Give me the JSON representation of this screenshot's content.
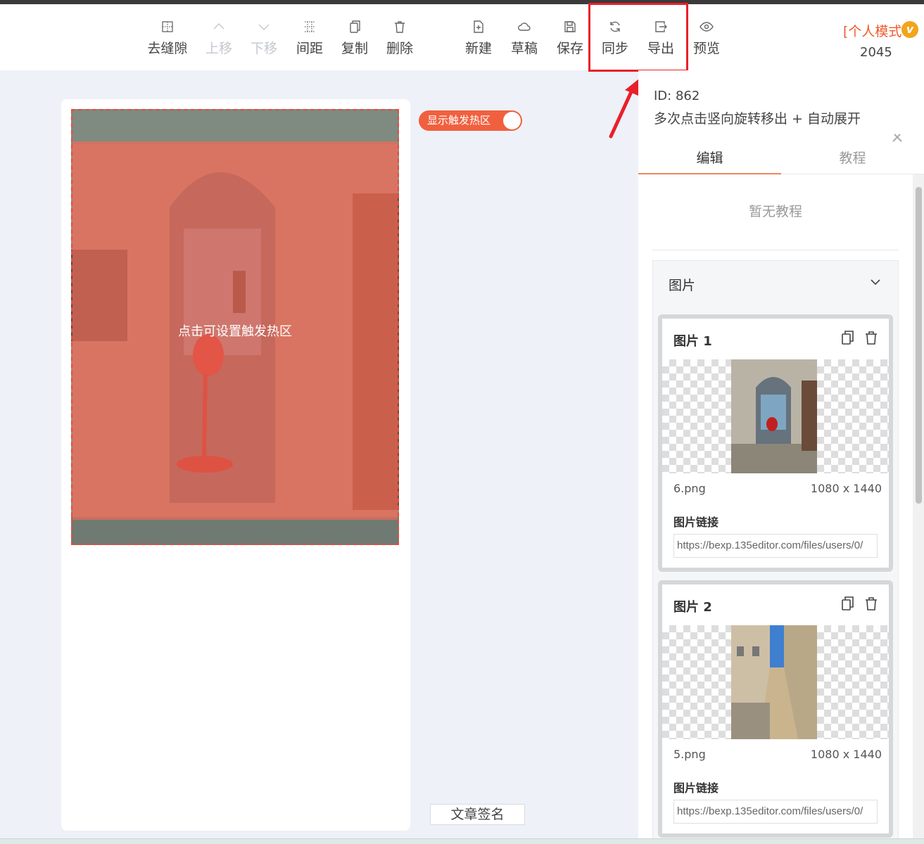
{
  "toolbar": {
    "items": [
      {
        "label": "去缝隙",
        "icon": "grid-dotted-icon",
        "disabled": false
      },
      {
        "label": "上移",
        "icon": "chevron-up-icon",
        "disabled": true
      },
      {
        "label": "下移",
        "icon": "chevron-down-icon",
        "disabled": true
      },
      {
        "label": "间距",
        "icon": "spacing-grid-icon",
        "disabled": false
      },
      {
        "label": "复制",
        "icon": "copy-icon",
        "disabled": false
      },
      {
        "label": "删除",
        "icon": "trash-icon",
        "disabled": false
      },
      {
        "label": "新建",
        "icon": "new-file-icon",
        "disabled": false
      },
      {
        "label": "草稿",
        "icon": "cloud-icon",
        "disabled": false
      },
      {
        "label": "保存",
        "icon": "save-icon",
        "disabled": false
      },
      {
        "label": "同步",
        "icon": "sync-icon",
        "disabled": false
      },
      {
        "label": "导出",
        "icon": "export-icon",
        "disabled": false
      },
      {
        "label": "预览",
        "icon": "eye-icon",
        "disabled": false
      }
    ],
    "mode": "[个人模式",
    "badge": "v",
    "user_id": "2045"
  },
  "canvas": {
    "hotzone_text": "点击可设置触发热区",
    "toggle_label": "显示触发热区",
    "toggle_on": true,
    "signature_button": "文章签名"
  },
  "panel": {
    "id_text": "ID: 862",
    "description": "多次点击竖向旋转移出 + 自动展开",
    "tabs": [
      {
        "label": "编辑",
        "active": true
      },
      {
        "label": "教程",
        "active": false
      }
    ],
    "no_tutorial": "暂无教程",
    "section_title": "图片",
    "images": [
      {
        "title": "图片 1",
        "filename": "6.png",
        "dimensions": "1080 x 1440",
        "link_label": "图片链接",
        "link_value": "https://bexp.135editor.com/files/users/0/"
      },
      {
        "title": "图片 2",
        "filename": "5.png",
        "dimensions": "1080 x 1440",
        "link_label": "图片链接",
        "link_value": "https://bexp.135editor.com/files/users/0/"
      }
    ]
  },
  "colors": {
    "accent": "#f0603f",
    "highlight": "#e8202a",
    "badge": "#f2a51a"
  }
}
